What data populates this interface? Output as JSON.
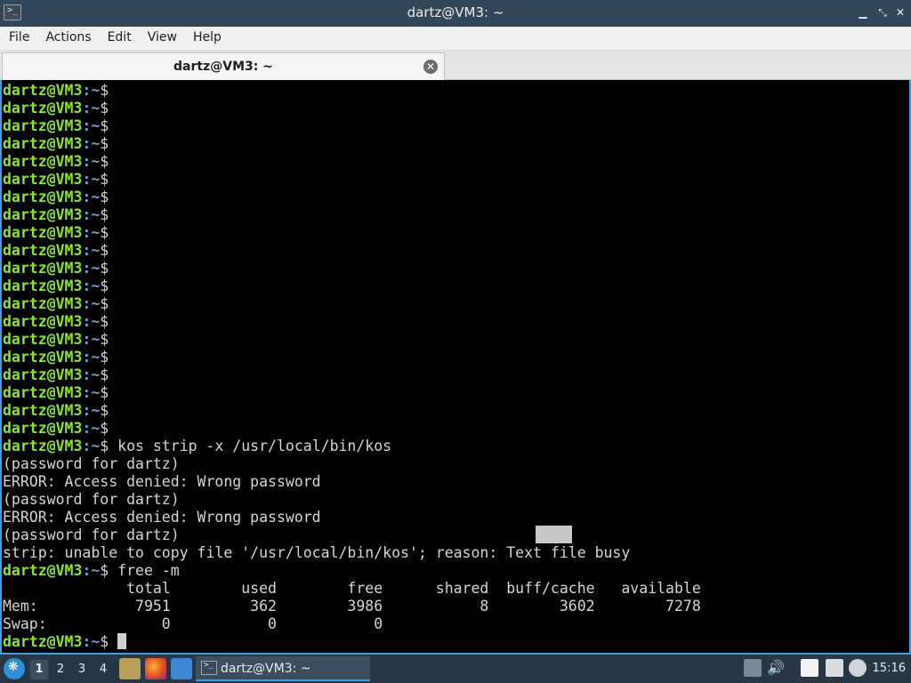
{
  "window": {
    "title": "dartz@VM3: ~"
  },
  "menu": [
    "File",
    "Actions",
    "Edit",
    "View",
    "Help"
  ],
  "tab": {
    "label": "dartz@VM3: ~"
  },
  "prompt": {
    "user": "dartz@VM3",
    "colon": ":",
    "path": "~",
    "symbol": "$"
  },
  "terminal": {
    "empty_prompt_count": 20,
    "cmd1": " kos strip -x /usr/local/bin/kos",
    "out1": "(password for dartz)",
    "out2": "ERROR: Access denied: Wrong password",
    "out3": "(password for dartz)",
    "out4": "ERROR: Access denied: Wrong password",
    "out5": "(password for dartz)",
    "out6": "strip: unable to copy file '/usr/local/bin/kos'; reason: Text file busy",
    "cmd2": " free -m",
    "free_header": "              total        used        free      shared  buff/cache   available",
    "free_mem": "Mem:           7951         362        3986           8        3602        7278",
    "free_swap": "Swap:             0           0           0",
    "cmd3": " "
  },
  "taskbar": {
    "workspaces": [
      "1",
      "2",
      "3",
      "4"
    ],
    "active_workspace": "1",
    "task_label": "dartz@VM3: ~",
    "clock": "15:16",
    "launchers": [
      "file-manager-icon",
      "firefox-icon",
      "desktop-icon"
    ],
    "tray": [
      "battery-icon",
      "volume-icon",
      "clipboard-icon",
      "network-icon",
      "notification-icon"
    ]
  }
}
